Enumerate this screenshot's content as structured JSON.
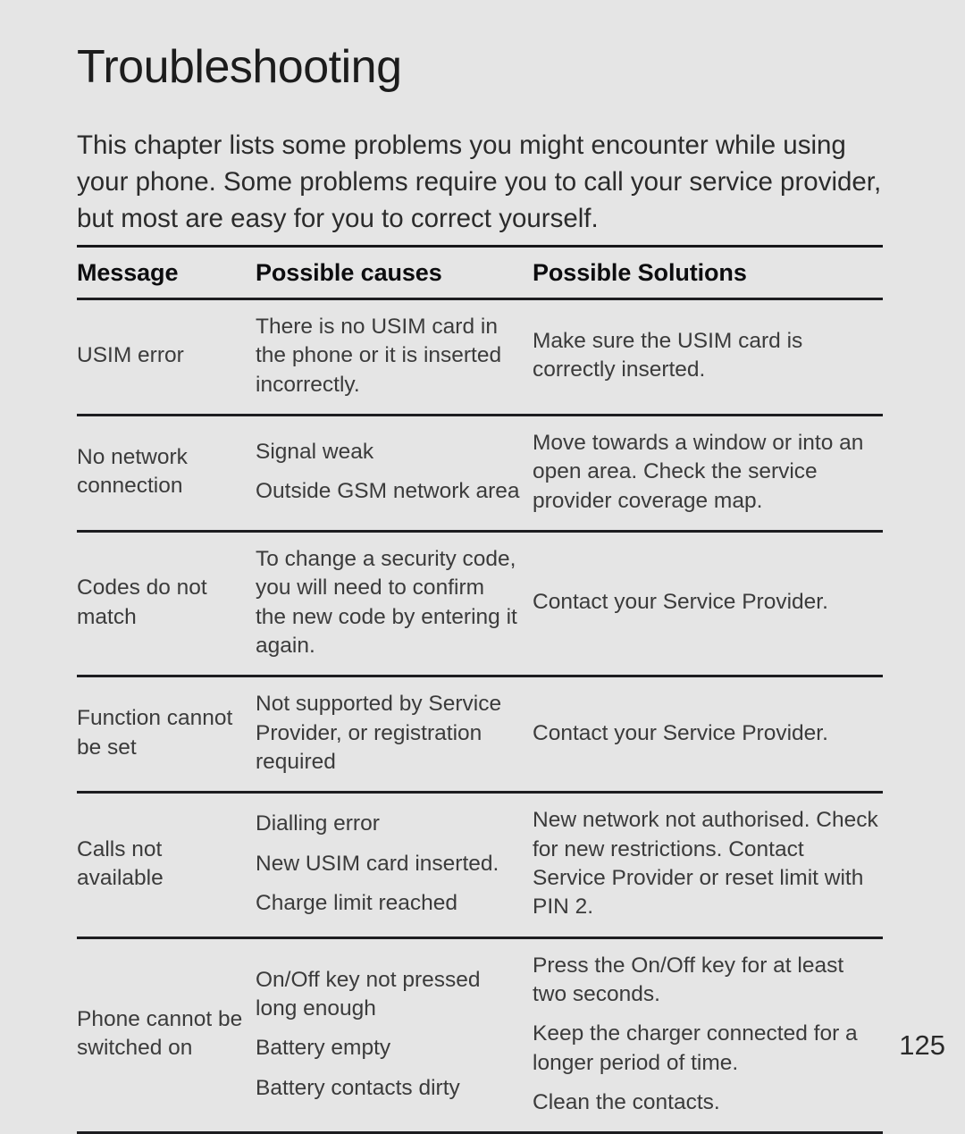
{
  "page": {
    "title": "Troubleshooting",
    "intro": "This chapter lists some problems you might encounter while using your phone. Some problems require you to call your service provider, but most are easy for you to correct yourself.",
    "page_number": "125",
    "background_color": "#e5e5e5",
    "text_color": "#3b3b3b",
    "heading_color": "#1c1c1c"
  },
  "table": {
    "headers": {
      "message": "Message",
      "causes": "Possible causes",
      "solutions": "Possible Solutions"
    },
    "rows": [
      {
        "message": "USIM error",
        "causes": [
          "There is no USIM card in the phone or it is inserted incorrectly."
        ],
        "solutions": [
          "Make sure the USIM card is correctly inserted."
        ]
      },
      {
        "message": "No network connection",
        "causes": [
          "Signal weak",
          "Outside GSM network area"
        ],
        "solutions": [
          "Move towards a window or into an open area. Check the service provider coverage map."
        ]
      },
      {
        "message": "Codes do not match",
        "causes": [
          "To change a security code, you will need to confirm the new code by entering it again."
        ],
        "solutions": [
          "Contact your Service Provider."
        ]
      },
      {
        "message": "Function cannot be set",
        "causes": [
          "Not supported by Service Provider, or registration required"
        ],
        "solutions": [
          "Contact your Service Provider."
        ]
      },
      {
        "message": "Calls not available",
        "causes": [
          "Dialling error",
          "New USIM card inserted.",
          "Charge limit reached"
        ],
        "solutions": [
          "New network not authorised. Check for new restrictions. Contact Service Provider or reset limit with PIN 2."
        ]
      },
      {
        "message": "Phone cannot be switched on",
        "causes": [
          "On/Off key not pressed long enough",
          "Battery empty",
          "Battery contacts dirty"
        ],
        "solutions": [
          "Press the On/Off key for at least two seconds.",
          "Keep the charger connected for a longer period of time.",
          "Clean the contacts."
        ]
      }
    ]
  }
}
